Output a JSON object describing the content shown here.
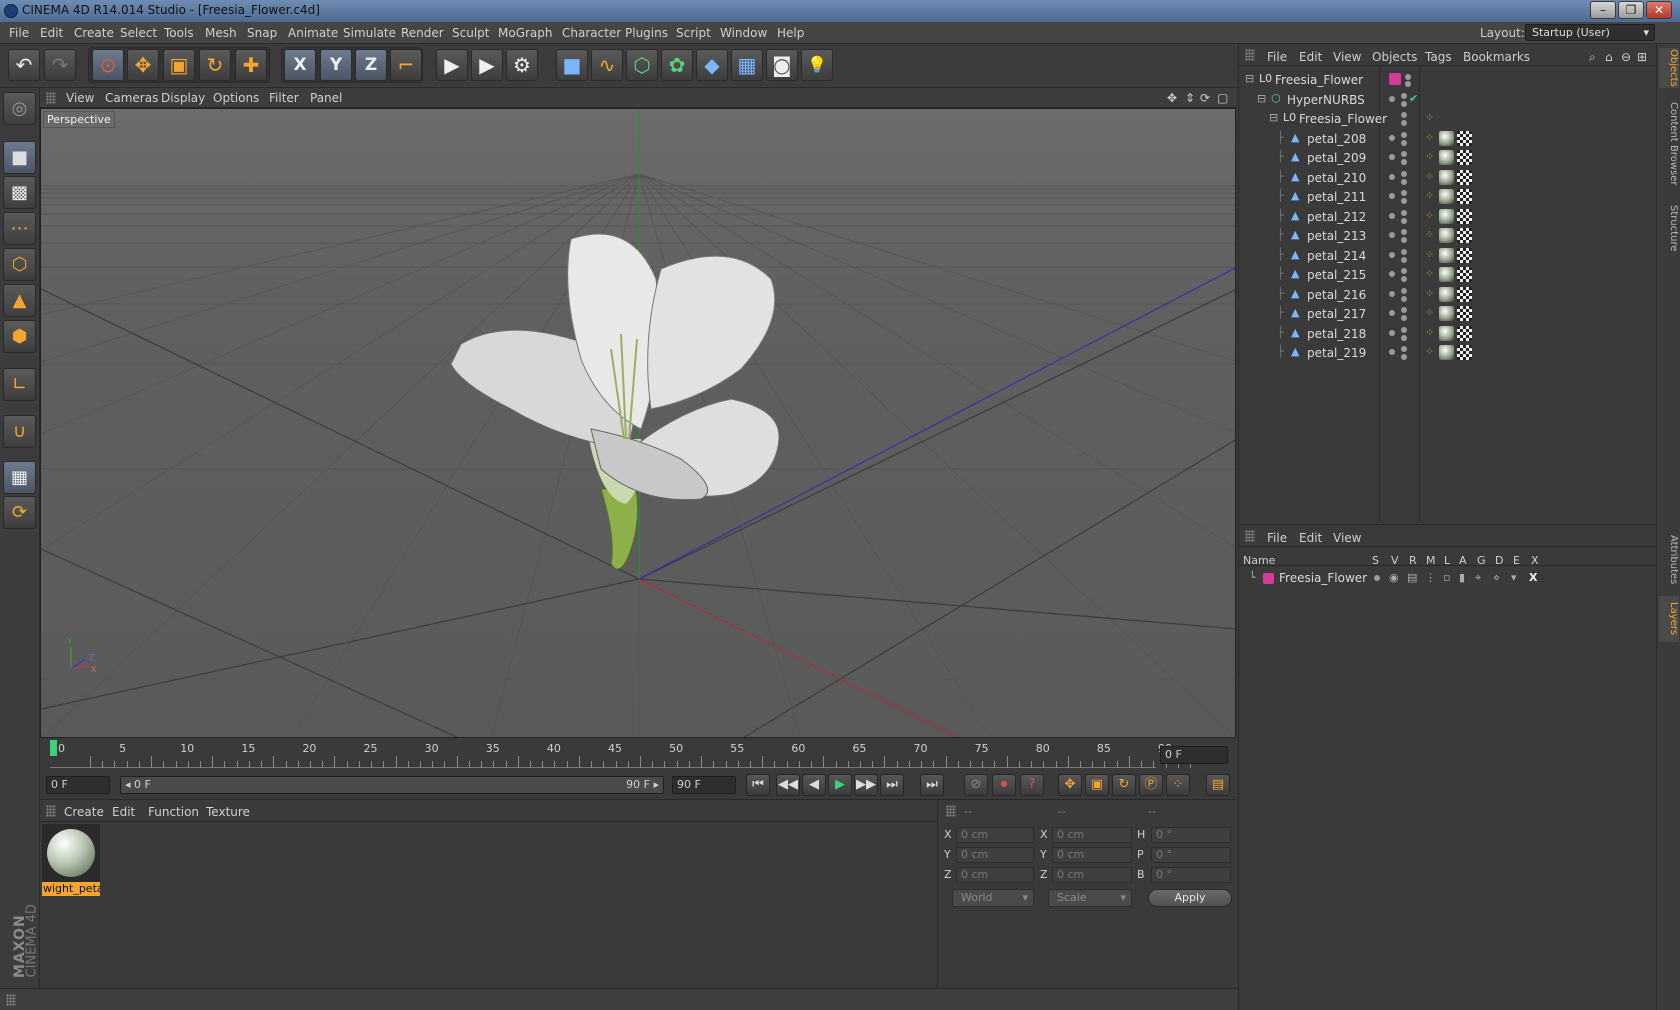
{
  "window": {
    "title": "CINEMA 4D R14.014 Studio - [Freesia_Flower.c4d]",
    "min": "–",
    "max": "❐",
    "close": "✕"
  },
  "menubar": {
    "items": [
      "File",
      "Edit",
      "Create",
      "Select",
      "Tools",
      "Mesh",
      "Snap",
      "Animate",
      "Simulate",
      "Render",
      "Sculpt",
      "MoGraph",
      "Character",
      "Plugins",
      "Script",
      "Window",
      "Help"
    ],
    "layout_label": "Layout:",
    "layout_value": "Startup (User)"
  },
  "toolbar": {
    "undo": "↶",
    "redo": "↷",
    "live_select": "⊙",
    "move": "✥",
    "scale": "▣",
    "rotate": "↻",
    "add": "✚",
    "axis_x": "X",
    "axis_y": "Y",
    "axis_z": "Z",
    "coord": "⌐",
    "render_view": "▶",
    "render_pv": "▶",
    "render_settings": "⚙",
    "cube": "■",
    "spline": "∿",
    "nurbs": "⬡",
    "array": "✿",
    "deform": "◆",
    "scene": "▦",
    "camera": "◙",
    "light": "💡"
  },
  "lefttools": [
    "◎",
    "■",
    "▩",
    "⋯",
    "⬡",
    "▲",
    "⬢",
    "∟",
    "∪",
    "▦",
    "⟳"
  ],
  "brand": {
    "line1": "MAXON",
    "line2": "CINEMA 4D"
  },
  "viewport": {
    "menu": [
      "View",
      "Cameras",
      "Display",
      "Options",
      "Filter",
      "Panel"
    ],
    "label": "Perspective",
    "nav_icons": [
      "✥",
      "⇕",
      "⟳",
      "▢"
    ],
    "axis_labels": {
      "y": "Y",
      "z": "Z",
      "x": "X"
    }
  },
  "timeline": {
    "ticks": [
      "0",
      "5",
      "10",
      "15",
      "20",
      "25",
      "30",
      "35",
      "40",
      "45",
      "50",
      "55",
      "60",
      "65",
      "70",
      "75",
      "80",
      "85",
      "90"
    ],
    "current_frame": "0 F"
  },
  "transport": {
    "start_field": "0 F",
    "range_start": "◂ 0 F",
    "range_end": "90 F ▸",
    "end_field": "90 F",
    "buttons": [
      "⏮",
      "◀◀",
      "◀",
      "▶",
      "▶▶",
      "⏭",
      "⏭"
    ]
  },
  "material_manager": {
    "menu": [
      "Create",
      "Edit",
      "Function",
      "Texture"
    ],
    "materials": [
      {
        "name": "wight_peta"
      }
    ]
  },
  "coordinates": {
    "header": [
      "--",
      "--",
      "--"
    ],
    "rows": [
      {
        "l1": "X",
        "v1": "0 cm",
        "l2": "X",
        "v2": "0 cm",
        "l3": "H",
        "v3": "0 °"
      },
      {
        "l1": "Y",
        "v1": "0 cm",
        "l2": "Y",
        "v2": "0 cm",
        "l3": "P",
        "v3": "0 °"
      },
      {
        "l1": "Z",
        "v1": "0 cm",
        "l2": "Z",
        "v2": "0 cm",
        "l3": "B",
        "v3": "0 °"
      }
    ],
    "mode": "World",
    "type": "Scale",
    "apply": "Apply"
  },
  "object_manager": {
    "menu": [
      "File",
      "Edit",
      "View",
      "Objects",
      "Tags",
      "Bookmarks"
    ],
    "objects": [
      {
        "name": "Freesia_Flower",
        "depth": 0,
        "kind": "null"
      },
      {
        "name": "HyperNURBS",
        "depth": 1,
        "kind": "nurbs"
      },
      {
        "name": "Freesia_Flower",
        "depth": 2,
        "kind": "null"
      },
      {
        "name": "petal_208",
        "depth": 3,
        "kind": "poly"
      },
      {
        "name": "petal_209",
        "depth": 3,
        "kind": "poly"
      },
      {
        "name": "petal_210",
        "depth": 3,
        "kind": "poly"
      },
      {
        "name": "petal_211",
        "depth": 3,
        "kind": "poly"
      },
      {
        "name": "petal_212",
        "depth": 3,
        "kind": "poly"
      },
      {
        "name": "petal_213",
        "depth": 3,
        "kind": "poly"
      },
      {
        "name": "petal_214",
        "depth": 3,
        "kind": "poly"
      },
      {
        "name": "petal_215",
        "depth": 3,
        "kind": "poly"
      },
      {
        "name": "petal_216",
        "depth": 3,
        "kind": "poly"
      },
      {
        "name": "petal_217",
        "depth": 3,
        "kind": "poly"
      },
      {
        "name": "petal_218",
        "depth": 3,
        "kind": "poly"
      },
      {
        "name": "petal_219",
        "depth": 3,
        "kind": "poly"
      }
    ],
    "checkmark": "✔"
  },
  "layer_manager": {
    "menu": [
      "File",
      "Edit",
      "View"
    ],
    "columns": [
      "Name",
      "S",
      "V",
      "R",
      "M",
      "L",
      "A",
      "G",
      "D",
      "E",
      "X"
    ],
    "layers": [
      {
        "name": "Freesia_Flower",
        "color": "#d63a9a"
      }
    ]
  },
  "right_tabs": [
    "Objects",
    "Content Browser",
    "Structure",
    "Attributes",
    "Layers"
  ],
  "colors": {
    "accent": "#f2a630",
    "selection": "#5a6a80",
    "layer": "#d63a9a"
  }
}
